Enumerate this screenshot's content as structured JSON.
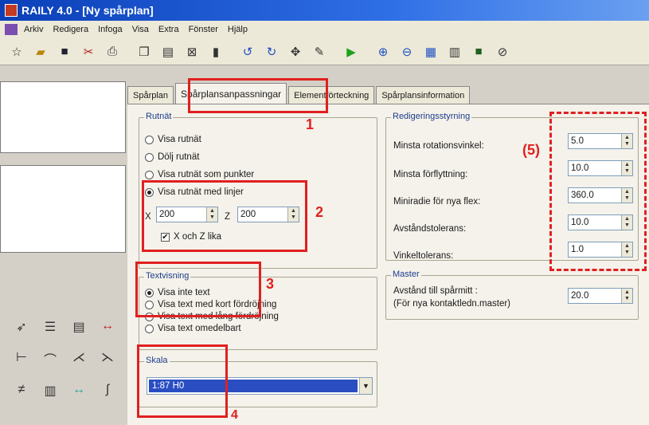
{
  "window": {
    "title": "RAILY 4.0 - [Ny spårplan]"
  },
  "menu": [
    "Arkiv",
    "Redigera",
    "Infoga",
    "Visa",
    "Extra",
    "Fönster",
    "Hjälp"
  ],
  "toolbar_icons": [
    "new-icon",
    "open-icon",
    "save-icon",
    "cut-icon",
    "print-icon",
    "copy-icon",
    "paste-icon",
    "delete-icon",
    "trash-icon",
    "rotate-left-icon",
    "rotate-right-icon",
    "move-icon",
    "pen-icon",
    "play-icon",
    "zoom-in-icon",
    "zoom-out-icon",
    "grid-icon",
    "layers-icon",
    "color-icon",
    "help-icon"
  ],
  "tabs": [
    "Spårplan",
    "Spårplansanpassningar",
    "Elementförteckning",
    "Spårplansinformation"
  ],
  "grid": {
    "legend": "Rutnät",
    "options": [
      "Visa rutnät",
      "Dölj rutnät",
      "Visa rutnät som punkter",
      "Visa rutnät med linjer"
    ],
    "selected": 3,
    "x_label": "X",
    "x_value": "200",
    "z_label": "Z",
    "z_value": "200",
    "xz_equal": "X och Z lika"
  },
  "text": {
    "legend": "Textvisning",
    "options": [
      "Visa inte text",
      "Visa text med kort fördröjning",
      "Visa text med lång fördröjning",
      "Visa text omedelbart"
    ],
    "selected": 0
  },
  "scale": {
    "legend": "Skala",
    "value": "1:87 H0"
  },
  "edit": {
    "legend": "Redigeringsstyrning",
    "rows": [
      {
        "label": "Minsta rotationsvinkel:",
        "value": "5.0"
      },
      {
        "label": "Minsta förflyttning:",
        "value": "10.0"
      },
      {
        "label": "Miniradie för nya flex:",
        "value": "360.0"
      },
      {
        "label": "Avståndstolerans:",
        "value": "10.0"
      },
      {
        "label": "Vinkeltolerans:",
        "value": "1.0"
      }
    ]
  },
  "master": {
    "legend": "Master",
    "label1": "Avstånd till spårmitt :",
    "label2": "(För nya kontaktledn.master)",
    "value": "20.0"
  },
  "annotations": [
    "1",
    "2",
    "3",
    "4",
    "(5)"
  ],
  "accent_color": "#e02020"
}
